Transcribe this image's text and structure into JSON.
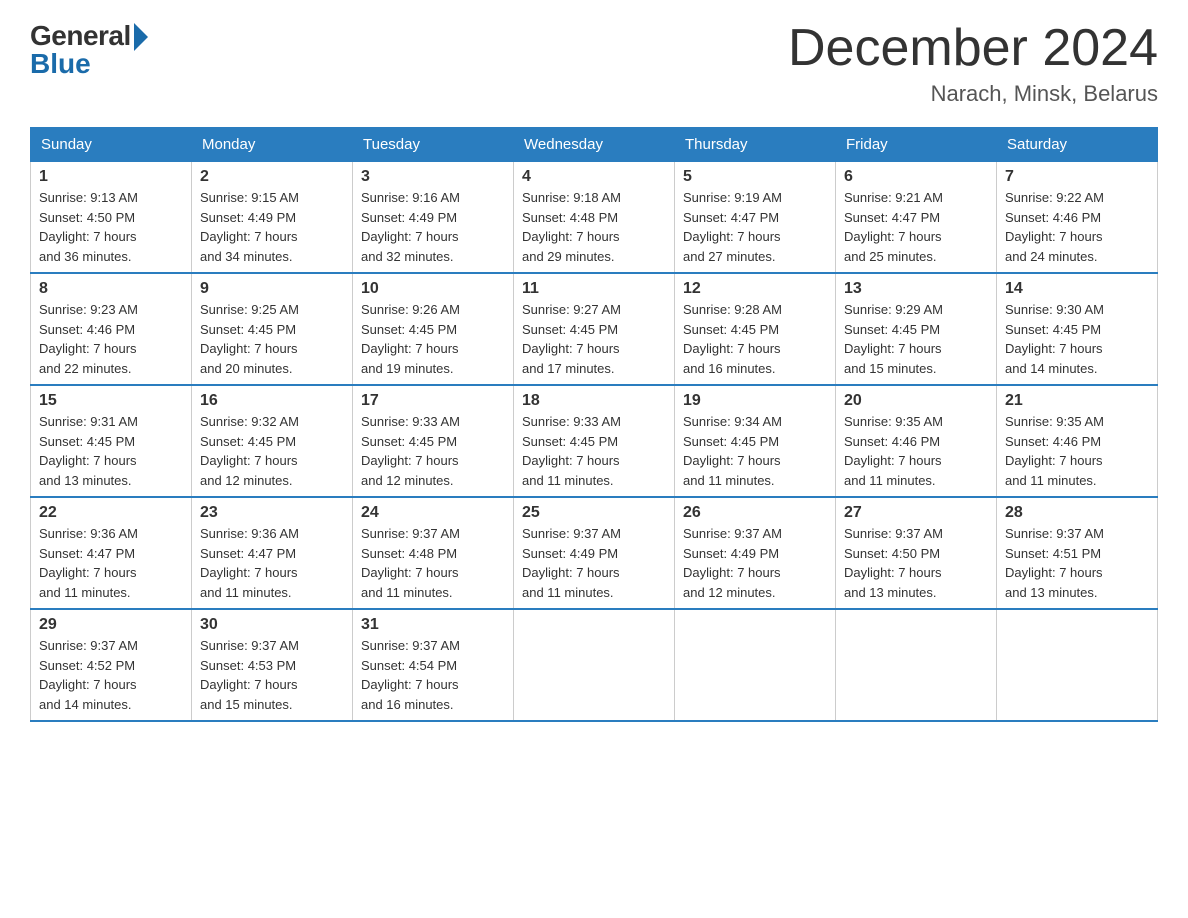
{
  "logo": {
    "general": "General",
    "blue": "Blue"
  },
  "title": "December 2024",
  "location": "Narach, Minsk, Belarus",
  "days_of_week": [
    "Sunday",
    "Monday",
    "Tuesday",
    "Wednesday",
    "Thursday",
    "Friday",
    "Saturday"
  ],
  "weeks": [
    [
      {
        "day": "1",
        "sunrise": "9:13 AM",
        "sunset": "4:50 PM",
        "daylight": "7 hours and 36 minutes."
      },
      {
        "day": "2",
        "sunrise": "9:15 AM",
        "sunset": "4:49 PM",
        "daylight": "7 hours and 34 minutes."
      },
      {
        "day": "3",
        "sunrise": "9:16 AM",
        "sunset": "4:49 PM",
        "daylight": "7 hours and 32 minutes."
      },
      {
        "day": "4",
        "sunrise": "9:18 AM",
        "sunset": "4:48 PM",
        "daylight": "7 hours and 29 minutes."
      },
      {
        "day": "5",
        "sunrise": "9:19 AM",
        "sunset": "4:47 PM",
        "daylight": "7 hours and 27 minutes."
      },
      {
        "day": "6",
        "sunrise": "9:21 AM",
        "sunset": "4:47 PM",
        "daylight": "7 hours and 25 minutes."
      },
      {
        "day": "7",
        "sunrise": "9:22 AM",
        "sunset": "4:46 PM",
        "daylight": "7 hours and 24 minutes."
      }
    ],
    [
      {
        "day": "8",
        "sunrise": "9:23 AM",
        "sunset": "4:46 PM",
        "daylight": "7 hours and 22 minutes."
      },
      {
        "day": "9",
        "sunrise": "9:25 AM",
        "sunset": "4:45 PM",
        "daylight": "7 hours and 20 minutes."
      },
      {
        "day": "10",
        "sunrise": "9:26 AM",
        "sunset": "4:45 PM",
        "daylight": "7 hours and 19 minutes."
      },
      {
        "day": "11",
        "sunrise": "9:27 AM",
        "sunset": "4:45 PM",
        "daylight": "7 hours and 17 minutes."
      },
      {
        "day": "12",
        "sunrise": "9:28 AM",
        "sunset": "4:45 PM",
        "daylight": "7 hours and 16 minutes."
      },
      {
        "day": "13",
        "sunrise": "9:29 AM",
        "sunset": "4:45 PM",
        "daylight": "7 hours and 15 minutes."
      },
      {
        "day": "14",
        "sunrise": "9:30 AM",
        "sunset": "4:45 PM",
        "daylight": "7 hours and 14 minutes."
      }
    ],
    [
      {
        "day": "15",
        "sunrise": "9:31 AM",
        "sunset": "4:45 PM",
        "daylight": "7 hours and 13 minutes."
      },
      {
        "day": "16",
        "sunrise": "9:32 AM",
        "sunset": "4:45 PM",
        "daylight": "7 hours and 12 minutes."
      },
      {
        "day": "17",
        "sunrise": "9:33 AM",
        "sunset": "4:45 PM",
        "daylight": "7 hours and 12 minutes."
      },
      {
        "day": "18",
        "sunrise": "9:33 AM",
        "sunset": "4:45 PM",
        "daylight": "7 hours and 11 minutes."
      },
      {
        "day": "19",
        "sunrise": "9:34 AM",
        "sunset": "4:45 PM",
        "daylight": "7 hours and 11 minutes."
      },
      {
        "day": "20",
        "sunrise": "9:35 AM",
        "sunset": "4:46 PM",
        "daylight": "7 hours and 11 minutes."
      },
      {
        "day": "21",
        "sunrise": "9:35 AM",
        "sunset": "4:46 PM",
        "daylight": "7 hours and 11 minutes."
      }
    ],
    [
      {
        "day": "22",
        "sunrise": "9:36 AM",
        "sunset": "4:47 PM",
        "daylight": "7 hours and 11 minutes."
      },
      {
        "day": "23",
        "sunrise": "9:36 AM",
        "sunset": "4:47 PM",
        "daylight": "7 hours and 11 minutes."
      },
      {
        "day": "24",
        "sunrise": "9:37 AM",
        "sunset": "4:48 PM",
        "daylight": "7 hours and 11 minutes."
      },
      {
        "day": "25",
        "sunrise": "9:37 AM",
        "sunset": "4:49 PM",
        "daylight": "7 hours and 11 minutes."
      },
      {
        "day": "26",
        "sunrise": "9:37 AM",
        "sunset": "4:49 PM",
        "daylight": "7 hours and 12 minutes."
      },
      {
        "day": "27",
        "sunrise": "9:37 AM",
        "sunset": "4:50 PM",
        "daylight": "7 hours and 13 minutes."
      },
      {
        "day": "28",
        "sunrise": "9:37 AM",
        "sunset": "4:51 PM",
        "daylight": "7 hours and 13 minutes."
      }
    ],
    [
      {
        "day": "29",
        "sunrise": "9:37 AM",
        "sunset": "4:52 PM",
        "daylight": "7 hours and 14 minutes."
      },
      {
        "day": "30",
        "sunrise": "9:37 AM",
        "sunset": "4:53 PM",
        "daylight": "7 hours and 15 minutes."
      },
      {
        "day": "31",
        "sunrise": "9:37 AM",
        "sunset": "4:54 PM",
        "daylight": "7 hours and 16 minutes."
      },
      null,
      null,
      null,
      null
    ]
  ],
  "labels": {
    "sunrise": "Sunrise:",
    "sunset": "Sunset:",
    "daylight": "Daylight:"
  }
}
